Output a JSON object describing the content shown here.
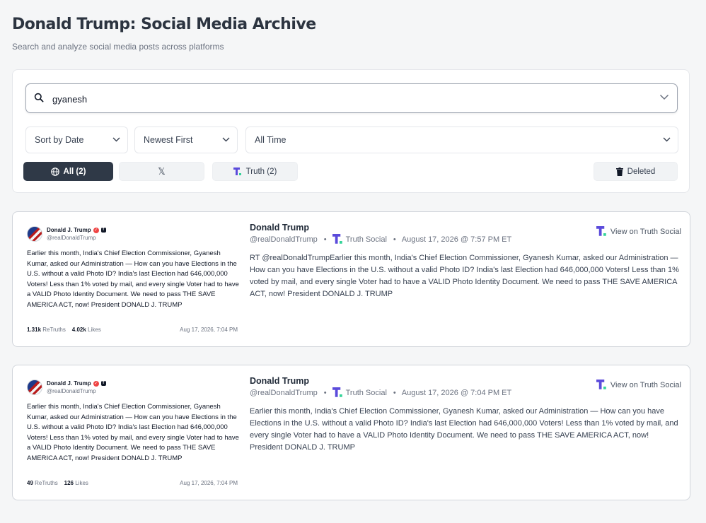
{
  "header": {
    "title": "Donald Trump: Social Media Archive",
    "subtitle": "Search and analyze social media posts across platforms"
  },
  "search": {
    "value": "gyanesh"
  },
  "filters": {
    "sort_by": "Sort by Date",
    "order": "Newest First",
    "time_range": "All Time"
  },
  "platform_buttons": {
    "all": "All (2)",
    "x": "𝕏",
    "truth": "Truth (2)",
    "deleted": "Deleted"
  },
  "colors": {
    "truth_brand": "#5b4bdb",
    "active_button": "#2f3947"
  },
  "posts": [
    {
      "author": "Donald Trump",
      "handle": "@realDonaldTrump",
      "platform": "Truth Social",
      "date": "August 17, 2026 @ 7:57 PM ET",
      "view_link": "View on Truth Social",
      "body": "RT @realDonaldTrumpEarlier this month, India's Chief Election Commissioner, Gyanesh Kumar, asked our Administration — How can you have Elections in the U.S. without a valid Photo ID? India's last Election had 646,000,000 Voters! Less than 1% voted by mail, and every single Voter had to have a VALID Photo Identity Document. We need to pass THE SAVE AMERICA ACT, now! President DONALD J. TRUMP",
      "screenshot": {
        "name": "Donald J. Trump",
        "handle": "@realDonaldTrump",
        "text": "Earlier this month, India's Chief Election Commissioner, Gyanesh Kumar, asked our Administration — How can you have Elections in the U.S. without a valid Photo ID? India's last Election had 646,000,000 Voters! Less than 1% voted by mail, and every single Voter had to have a VALID Photo Identity Document. We need to pass THE SAVE AMERICA ACT, now! President DONALD J. TRUMP",
        "retruths": "1.31k",
        "retruths_label": "ReTruths",
        "likes": "4.02k",
        "likes_label": "Likes",
        "date": "Aug 17, 2026, 7:04 PM"
      }
    },
    {
      "author": "Donald Trump",
      "handle": "@realDonaldTrump",
      "platform": "Truth Social",
      "date": "August 17, 2026 @ 7:04 PM ET",
      "view_link": "View on Truth Social",
      "body": "Earlier this month, India's Chief Election Commissioner, Gyanesh Kumar, asked our Administration — How can you have Elections in the U.S. without a valid Photo ID? India's last Election had 646,000,000 Voters! Less than 1% voted by mail, and every single Voter had to have a VALID Photo Identity Document. We need to pass THE SAVE AMERICA ACT, now! President DONALD J. TRUMP",
      "screenshot": {
        "name": "Donald J. Trump",
        "handle": "@realDonaldTrump",
        "text": "Earlier this month, India's Chief Election Commissioner, Gyanesh Kumar, asked our Administration — How can you have Elections in the U.S. without a valid Photo ID? India's last Election had 646,000,000 Voters! Less than 1% voted by mail, and every single Voter had to have a VALID Photo Identity Document. We need to pass THE SAVE AMERICA ACT, now! President DONALD J. TRUMP",
        "retruths": "49",
        "retruths_label": "ReTruths",
        "likes": "126",
        "likes_label": "Likes",
        "date": "Aug 17, 2026, 7:04 PM"
      }
    }
  ]
}
